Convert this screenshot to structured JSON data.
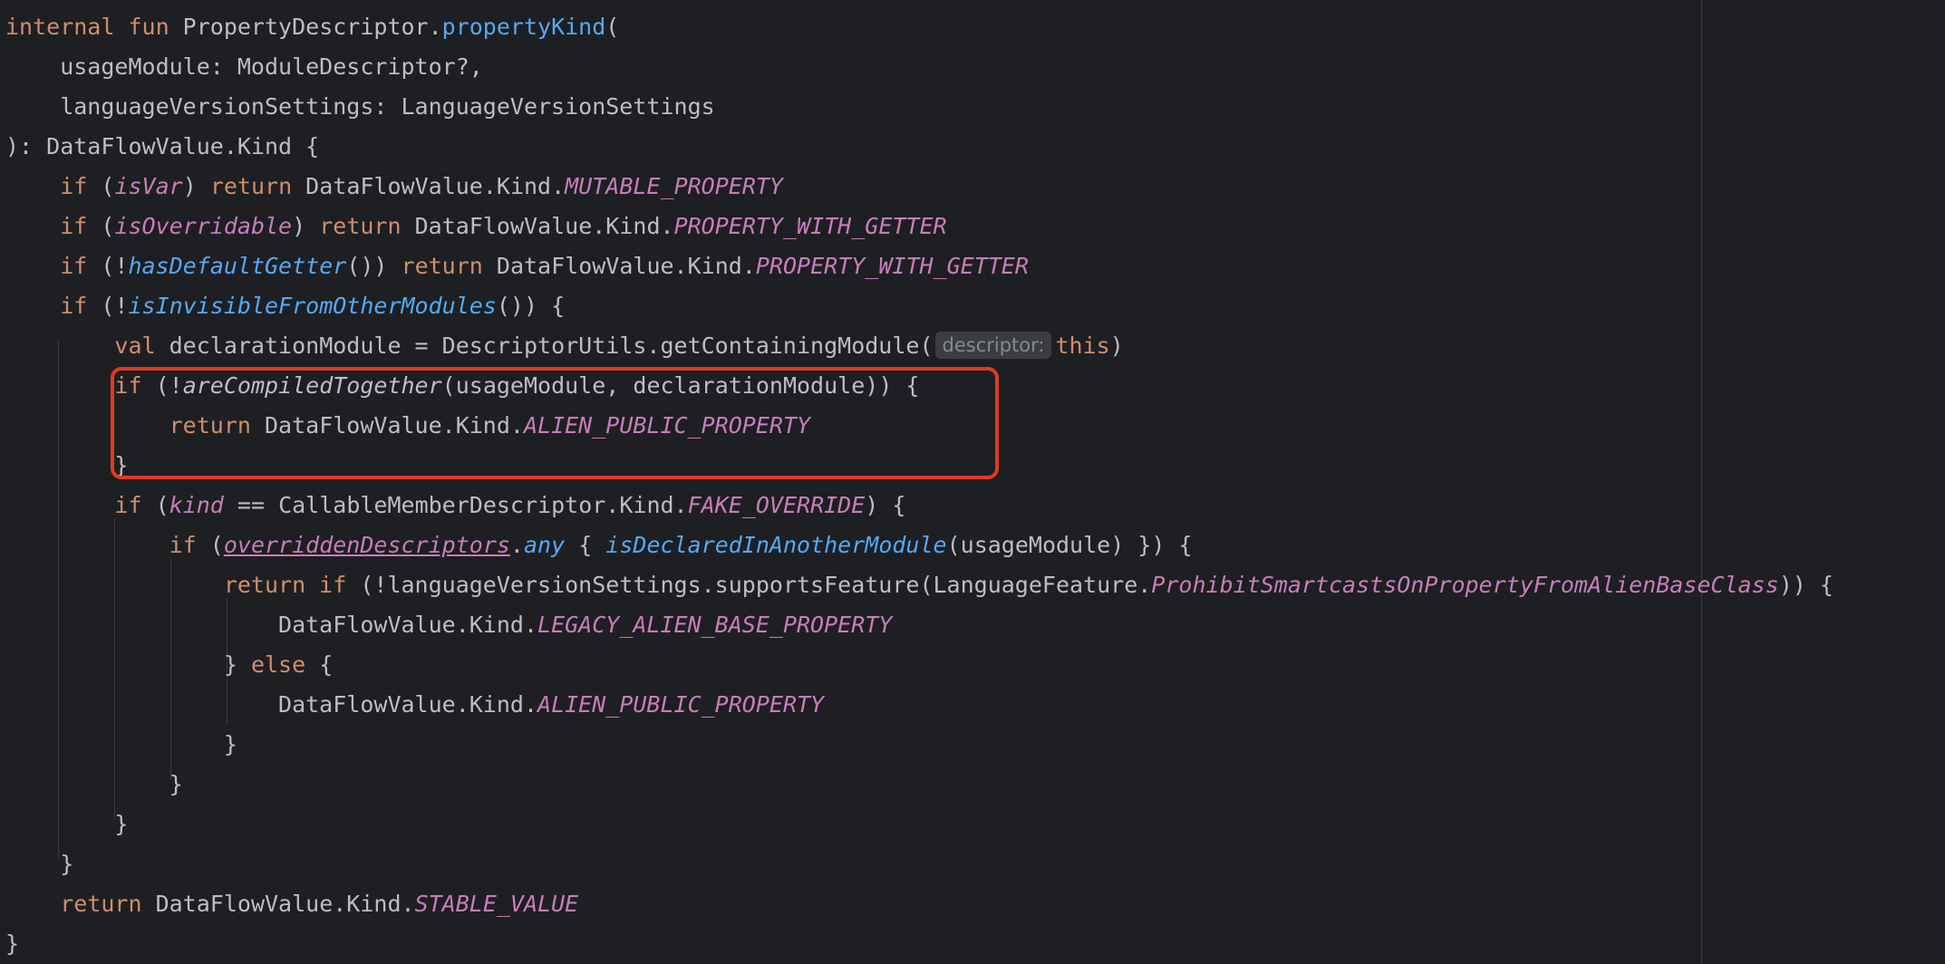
{
  "colors": {
    "background": "#1e1f22",
    "keyword": "#cf8e6d",
    "function": "#56a8f5",
    "constant": "#c77dbb",
    "default_text": "#bcbec4",
    "highlight_border": "#e03a24"
  },
  "code": {
    "l1": {
      "kw": "internal fun",
      "recv": " PropertyDescriptor.",
      "fn": "propertyKind",
      "tail": "("
    },
    "l2": {
      "text": "    usageModule: ModuleDescriptor?,"
    },
    "l3": {
      "text": "    languageVersionSettings: LanguageVersionSettings"
    },
    "l4": {
      "text": "): DataFlowValue.Kind {"
    },
    "l5": {
      "indent": "    ",
      "kw": "if",
      "p1": " (",
      "prop": "isVar",
      "p2": ") ",
      "kw2": "return",
      "mid": " DataFlowValue.Kind.",
      "const": "MUTABLE_PROPERTY"
    },
    "l6": {
      "indent": "    ",
      "kw": "if",
      "p1": " (",
      "prop": "isOverridable",
      "p2": ") ",
      "kw2": "return",
      "mid": " DataFlowValue.Kind.",
      "const": "PROPERTY_WITH_GETTER"
    },
    "l7": {
      "indent": "    ",
      "kw": "if",
      "p1": " (!",
      "fn": "hasDefaultGetter",
      "p2": "()) ",
      "kw2": "return",
      "mid": " DataFlowValue.Kind.",
      "const": "PROPERTY_WITH_GETTER"
    },
    "l8": {
      "indent": "    ",
      "kw": "if",
      "p1": " (!",
      "fn": "isInvisibleFromOtherModules",
      "p2": "()) {"
    },
    "l9": {
      "indent": "        ",
      "kw": "val",
      "mid": " declarationModule = DescriptorUtils.getContainingModule(",
      "hint": "descriptor:",
      "kw2": "this",
      "tail": ")"
    },
    "l10": {
      "indent": "        ",
      "kw": "if",
      "p1": " (!",
      "fn": "areCompiledTogether",
      "tail": "(usageModule, declarationModule)) {"
    },
    "l11": {
      "indent": "            ",
      "kw": "return",
      "mid": " DataFlowValue.Kind.",
      "const": "ALIEN_PUBLIC_PROPERTY"
    },
    "l12": {
      "text": "        }"
    },
    "l13": {
      "indent": "        ",
      "kw": "if",
      "p1": " (",
      "prop": "kind",
      "mid": " == CallableMemberDescriptor.Kind.",
      "const": "FAKE_OVERRIDE",
      "tail": ") {"
    },
    "l14": {
      "indent": "            ",
      "kw": "if",
      "p1": " (",
      "ext": "overriddenDescriptors",
      "dot": ".",
      "fn1": "any",
      "mid": " { ",
      "fn2": "isDeclaredInAnotherModule",
      "tail": "(usageModule) }) {"
    },
    "l15": {
      "indent": "                ",
      "kw": "return if",
      "mid": " (!languageVersionSettings.supportsFeature(LanguageFeature.",
      "const": "ProhibitSmartcastsOnPropertyFromAlienBaseClass",
      "tail": ")) {"
    },
    "l16": {
      "indent": "                    ",
      "mid": "DataFlowValue.Kind.",
      "const": "LEGACY_ALIEN_BASE_PROPERTY"
    },
    "l17": {
      "indent": "                ",
      "p1": "} ",
      "kw": "else",
      "tail": " {"
    },
    "l18": {
      "indent": "                    ",
      "mid": "DataFlowValue.Kind.",
      "const": "ALIEN_PUBLIC_PROPERTY"
    },
    "l19": {
      "text": "                }"
    },
    "l20": {
      "text": "            }"
    },
    "l21": {
      "text": "        }"
    },
    "l22": {
      "text": "    }"
    },
    "l23": {
      "indent": "    ",
      "kw": "return",
      "mid": " DataFlowValue.Kind.",
      "const": "STABLE_VALUE"
    },
    "l24": {
      "text": "}"
    }
  }
}
